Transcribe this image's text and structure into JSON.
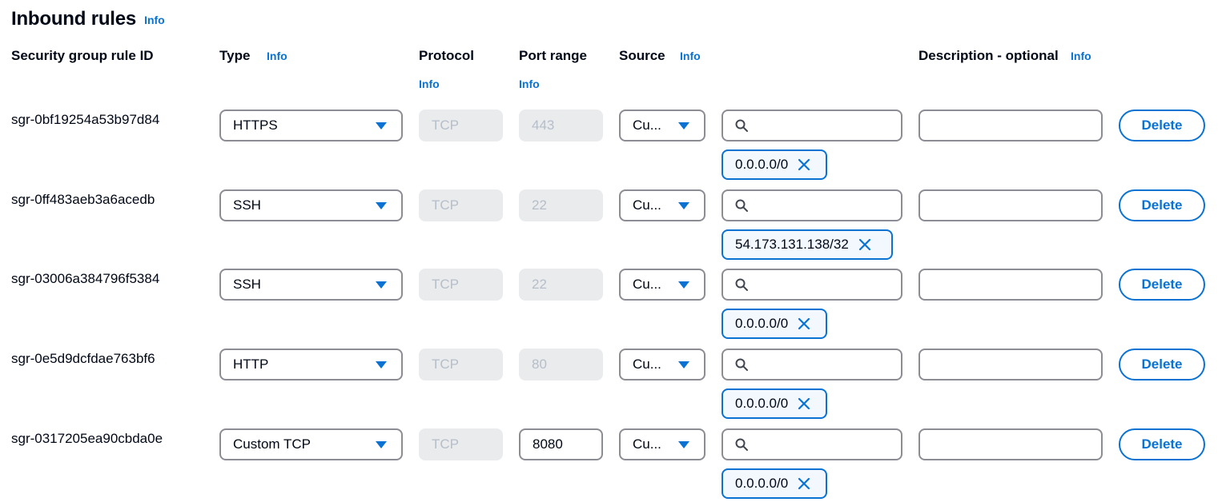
{
  "section": {
    "title": "Inbound rules",
    "info": "Info"
  },
  "headers": {
    "rule_id": "Security group rule ID",
    "type": "Type",
    "type_info": "Info",
    "protocol": "Protocol",
    "protocol_info": "Info",
    "port_range": "Port range",
    "port_range_info": "Info",
    "source": "Source",
    "source_info": "Info",
    "description": "Description - optional",
    "description_info": "Info"
  },
  "rules": [
    {
      "id": "sgr-0bf19254a53b97d84",
      "type": "HTTPS",
      "protocol": "TCP",
      "port": "443",
      "port_editable": false,
      "source_type": "Cu...",
      "search_value": "",
      "token": "0.0.0.0/0",
      "description": "",
      "delete": "Delete"
    },
    {
      "id": "sgr-0ff483aeb3a6acedb",
      "type": "SSH",
      "protocol": "TCP",
      "port": "22",
      "port_editable": false,
      "source_type": "Cu...",
      "search_value": "",
      "token": "54.173.131.138/32",
      "description": "",
      "delete": "Delete"
    },
    {
      "id": "sgr-03006a384796f5384",
      "type": "SSH",
      "protocol": "TCP",
      "port": "22",
      "port_editable": false,
      "source_type": "Cu...",
      "search_value": "",
      "token": "0.0.0.0/0",
      "description": "",
      "delete": "Delete"
    },
    {
      "id": "sgr-0e5d9dcfdae763bf6",
      "type": "HTTP",
      "protocol": "TCP",
      "port": "80",
      "port_editable": false,
      "source_type": "Cu...",
      "search_value": "",
      "token": "0.0.0.0/0",
      "description": "",
      "delete": "Delete"
    },
    {
      "id": "sgr-0317205ea90cbda0e",
      "type": "Custom TCP",
      "protocol": "TCP",
      "port": "8080",
      "port_editable": true,
      "source_type": "Cu...",
      "search_value": "",
      "token": "0.0.0.0/0",
      "description": "",
      "delete": "Delete"
    }
  ],
  "icons": {
    "search": "search-icon",
    "caret": "caret-down-icon",
    "remove": "close-icon"
  },
  "colors": {
    "accent": "#0972d3",
    "border": "#8c8c94",
    "disabled_bg": "#e9ebed",
    "disabled_text": "#b6bec9",
    "token_bg": "#f2f8fd"
  }
}
